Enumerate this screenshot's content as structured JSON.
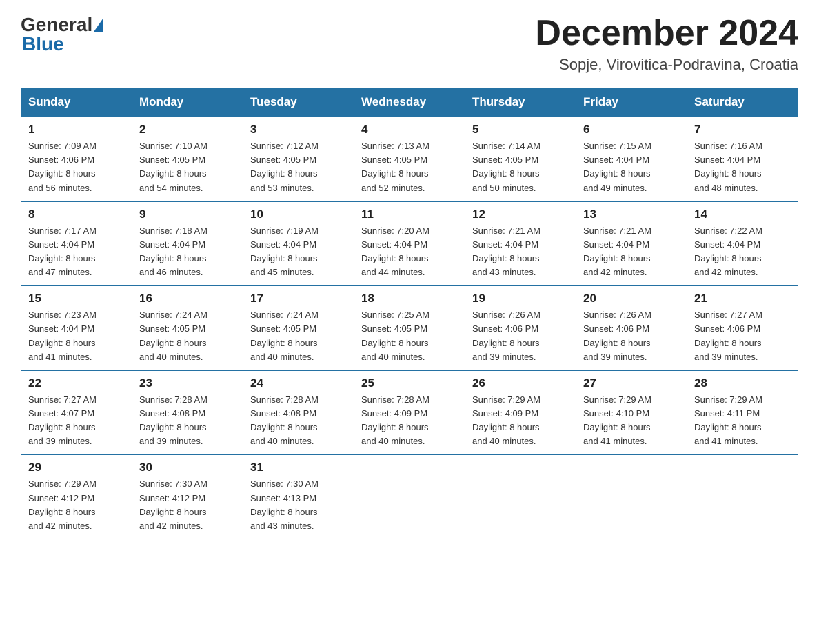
{
  "header": {
    "logo_general": "General",
    "logo_blue": "Blue",
    "month_title": "December 2024",
    "location": "Sopje, Virovitica-Podravina, Croatia"
  },
  "days_of_week": [
    "Sunday",
    "Monday",
    "Tuesday",
    "Wednesday",
    "Thursday",
    "Friday",
    "Saturday"
  ],
  "weeks": [
    [
      {
        "day": "1",
        "sunrise": "7:09 AM",
        "sunset": "4:06 PM",
        "daylight": "8 hours and 56 minutes."
      },
      {
        "day": "2",
        "sunrise": "7:10 AM",
        "sunset": "4:05 PM",
        "daylight": "8 hours and 54 minutes."
      },
      {
        "day": "3",
        "sunrise": "7:12 AM",
        "sunset": "4:05 PM",
        "daylight": "8 hours and 53 minutes."
      },
      {
        "day": "4",
        "sunrise": "7:13 AM",
        "sunset": "4:05 PM",
        "daylight": "8 hours and 52 minutes."
      },
      {
        "day": "5",
        "sunrise": "7:14 AM",
        "sunset": "4:05 PM",
        "daylight": "8 hours and 50 minutes."
      },
      {
        "day": "6",
        "sunrise": "7:15 AM",
        "sunset": "4:04 PM",
        "daylight": "8 hours and 49 minutes."
      },
      {
        "day": "7",
        "sunrise": "7:16 AM",
        "sunset": "4:04 PM",
        "daylight": "8 hours and 48 minutes."
      }
    ],
    [
      {
        "day": "8",
        "sunrise": "7:17 AM",
        "sunset": "4:04 PM",
        "daylight": "8 hours and 47 minutes."
      },
      {
        "day": "9",
        "sunrise": "7:18 AM",
        "sunset": "4:04 PM",
        "daylight": "8 hours and 46 minutes."
      },
      {
        "day": "10",
        "sunrise": "7:19 AM",
        "sunset": "4:04 PM",
        "daylight": "8 hours and 45 minutes."
      },
      {
        "day": "11",
        "sunrise": "7:20 AM",
        "sunset": "4:04 PM",
        "daylight": "8 hours and 44 minutes."
      },
      {
        "day": "12",
        "sunrise": "7:21 AM",
        "sunset": "4:04 PM",
        "daylight": "8 hours and 43 minutes."
      },
      {
        "day": "13",
        "sunrise": "7:21 AM",
        "sunset": "4:04 PM",
        "daylight": "8 hours and 42 minutes."
      },
      {
        "day": "14",
        "sunrise": "7:22 AM",
        "sunset": "4:04 PM",
        "daylight": "8 hours and 42 minutes."
      }
    ],
    [
      {
        "day": "15",
        "sunrise": "7:23 AM",
        "sunset": "4:04 PM",
        "daylight": "8 hours and 41 minutes."
      },
      {
        "day": "16",
        "sunrise": "7:24 AM",
        "sunset": "4:05 PM",
        "daylight": "8 hours and 40 minutes."
      },
      {
        "day": "17",
        "sunrise": "7:24 AM",
        "sunset": "4:05 PM",
        "daylight": "8 hours and 40 minutes."
      },
      {
        "day": "18",
        "sunrise": "7:25 AM",
        "sunset": "4:05 PM",
        "daylight": "8 hours and 40 minutes."
      },
      {
        "day": "19",
        "sunrise": "7:26 AM",
        "sunset": "4:06 PM",
        "daylight": "8 hours and 39 minutes."
      },
      {
        "day": "20",
        "sunrise": "7:26 AM",
        "sunset": "4:06 PM",
        "daylight": "8 hours and 39 minutes."
      },
      {
        "day": "21",
        "sunrise": "7:27 AM",
        "sunset": "4:06 PM",
        "daylight": "8 hours and 39 minutes."
      }
    ],
    [
      {
        "day": "22",
        "sunrise": "7:27 AM",
        "sunset": "4:07 PM",
        "daylight": "8 hours and 39 minutes."
      },
      {
        "day": "23",
        "sunrise": "7:28 AM",
        "sunset": "4:08 PM",
        "daylight": "8 hours and 39 minutes."
      },
      {
        "day": "24",
        "sunrise": "7:28 AM",
        "sunset": "4:08 PM",
        "daylight": "8 hours and 40 minutes."
      },
      {
        "day": "25",
        "sunrise": "7:28 AM",
        "sunset": "4:09 PM",
        "daylight": "8 hours and 40 minutes."
      },
      {
        "day": "26",
        "sunrise": "7:29 AM",
        "sunset": "4:09 PM",
        "daylight": "8 hours and 40 minutes."
      },
      {
        "day": "27",
        "sunrise": "7:29 AM",
        "sunset": "4:10 PM",
        "daylight": "8 hours and 41 minutes."
      },
      {
        "day": "28",
        "sunrise": "7:29 AM",
        "sunset": "4:11 PM",
        "daylight": "8 hours and 41 minutes."
      }
    ],
    [
      {
        "day": "29",
        "sunrise": "7:29 AM",
        "sunset": "4:12 PM",
        "daylight": "8 hours and 42 minutes."
      },
      {
        "day": "30",
        "sunrise": "7:30 AM",
        "sunset": "4:12 PM",
        "daylight": "8 hours and 42 minutes."
      },
      {
        "day": "31",
        "sunrise": "7:30 AM",
        "sunset": "4:13 PM",
        "daylight": "8 hours and 43 minutes."
      },
      null,
      null,
      null,
      null
    ]
  ],
  "labels": {
    "sunrise": "Sunrise:",
    "sunset": "Sunset:",
    "daylight": "Daylight:"
  }
}
